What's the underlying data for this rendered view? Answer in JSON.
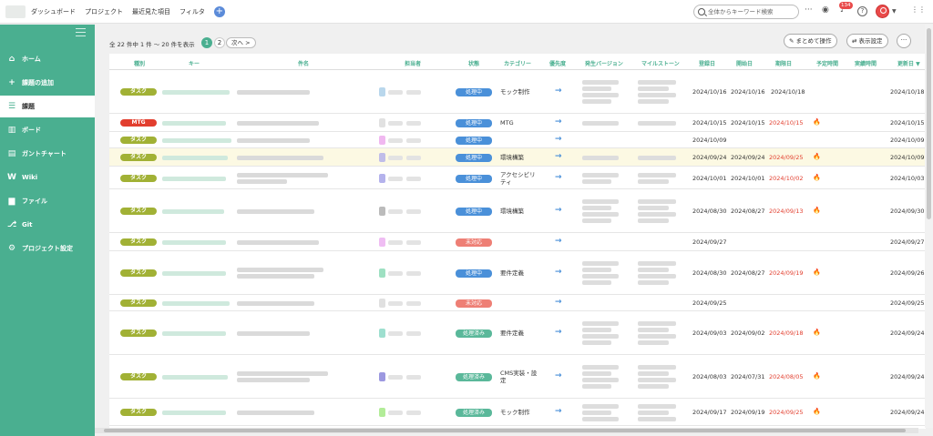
{
  "topbar": {
    "nav": [
      "ダッシュボード",
      "プロジェクト",
      "最近見た項目",
      "フィルタ"
    ],
    "add_label": "+",
    "search_placeholder": "全体からキーワード検索",
    "notifications": "134"
  },
  "sidebar": {
    "items": [
      {
        "label": "ホーム",
        "icon": "home-icon",
        "glyph": "⌂"
      },
      {
        "label": "課題の追加",
        "icon": "plus-icon",
        "glyph": "+"
      },
      {
        "label": "課題",
        "icon": "list-icon",
        "glyph": "☰"
      },
      {
        "label": "ボード",
        "icon": "board-icon",
        "glyph": "▥"
      },
      {
        "label": "ガントチャート",
        "icon": "gantt-icon",
        "glyph": "▤"
      },
      {
        "label": "Wiki",
        "icon": "wiki-icon",
        "glyph": "W"
      },
      {
        "label": "ファイル",
        "icon": "folder-icon",
        "glyph": "▆"
      },
      {
        "label": "Git",
        "icon": "git-icon",
        "glyph": "⎇"
      },
      {
        "label": "プロジェクト設定",
        "icon": "gear-icon",
        "glyph": "⚙"
      }
    ],
    "active_index": 2
  },
  "toolbar": {
    "count_text": "全 22 件中 1 件 〜 20 件を表示",
    "pages": [
      "1",
      "2"
    ],
    "next_label": "次へ >",
    "bulk_label": "まとめて操作",
    "display_label": "表示設定",
    "more_label": "···"
  },
  "table": {
    "headers": [
      "種別",
      "キー",
      "件名",
      "担当者",
      "状態",
      "カテゴリー",
      "優先度",
      "発生バージョン",
      "マイルストーン",
      "登録日",
      "開始日",
      "期限日",
      "予定時間",
      "実績時間",
      "更新日 ▼"
    ],
    "rows": [
      {
        "type": "タスク",
        "status": "処理中",
        "category": "モック制作",
        "registered": "2024/10/16",
        "start": "2024/10/16",
        "due": "2024/10/18",
        "overdue": false,
        "updated": "2024/10/18",
        "priority": "→"
      },
      {
        "type": "MTG",
        "status": "処理中",
        "category": "MTG",
        "registered": "2024/10/15",
        "start": "2024/10/15",
        "due": "2024/10/15",
        "overdue": true,
        "updated": "2024/10/15",
        "priority": "→"
      },
      {
        "type": "タスク",
        "status": "処理中",
        "category": "",
        "registered": "2024/10/09",
        "start": "",
        "due": "",
        "overdue": false,
        "updated": "2024/10/09",
        "priority": "→"
      },
      {
        "type": "タスク",
        "status": "処理中",
        "category": "環境構築",
        "registered": "2024/09/24",
        "start": "2024/09/24",
        "due": "2024/09/25",
        "overdue": true,
        "updated": "2024/10/09",
        "priority": "→"
      },
      {
        "type": "タスク",
        "status": "処理中",
        "category": "アクセシビリティ",
        "registered": "2024/10/01",
        "start": "2024/10/01",
        "due": "2024/10/02",
        "overdue": true,
        "updated": "2024/10/03",
        "priority": "→"
      },
      {
        "type": "タスク",
        "status": "処理中",
        "category": "環境構築",
        "registered": "2024/08/30",
        "start": "2024/08/27",
        "due": "2024/09/13",
        "overdue": true,
        "updated": "2024/09/30",
        "priority": "→"
      },
      {
        "type": "タスク",
        "status": "未対応",
        "category": "",
        "registered": "2024/09/27",
        "start": "",
        "due": "",
        "overdue": false,
        "updated": "2024/09/27",
        "priority": "→"
      },
      {
        "type": "タスク",
        "status": "処理中",
        "category": "要件定義",
        "registered": "2024/08/30",
        "start": "2024/08/27",
        "due": "2024/09/19",
        "overdue": true,
        "updated": "2024/09/26",
        "priority": "→"
      },
      {
        "type": "タスク",
        "status": "未対応",
        "category": "",
        "registered": "2024/09/25",
        "start": "",
        "due": "",
        "overdue": false,
        "updated": "2024/09/25",
        "priority": "→"
      },
      {
        "type": "タスク",
        "status": "処理済み",
        "category": "要件定義",
        "registered": "2024/09/03",
        "start": "2024/09/02",
        "due": "2024/09/18",
        "overdue": true,
        "updated": "2024/09/24",
        "priority": "→"
      },
      {
        "type": "タスク",
        "status": "処理済み",
        "category": "CMS実装・設定",
        "registered": "2024/08/03",
        "start": "2024/07/31",
        "due": "2024/08/05",
        "overdue": true,
        "updated": "2024/09/24",
        "priority": "→"
      },
      {
        "type": "タスク",
        "status": "処理済み",
        "category": "モック制作",
        "registered": "2024/09/17",
        "start": "2024/09/19",
        "due": "2024/09/25",
        "overdue": true,
        "updated": "2024/09/24",
        "priority": "→"
      }
    ]
  },
  "colors": {
    "brand": "#4aaf90",
    "task_badge": "#a1b135",
    "mtg_badge": "#e23e2e",
    "status_in_progress": "#4a90d9",
    "status_open": "#ee7f75",
    "status_resolved": "#5ab89a",
    "overdue": "#e23e2e"
  }
}
